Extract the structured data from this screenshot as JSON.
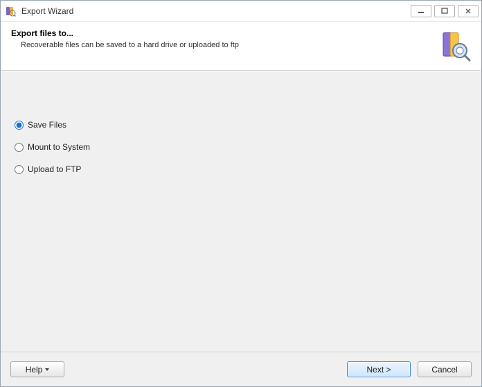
{
  "window": {
    "title": "Export Wizard"
  },
  "header": {
    "title": "Export files to...",
    "subtitle": "Recoverable files can be saved to a hard drive or uploaded to ftp"
  },
  "options": {
    "save_files": {
      "label": "Save Files",
      "selected": true
    },
    "mount": {
      "label": "Mount to System",
      "selected": false
    },
    "upload_ftp": {
      "label": "Upload to FTP",
      "selected": false
    }
  },
  "footer": {
    "help": "Help",
    "next": "Next >",
    "cancel": "Cancel"
  }
}
